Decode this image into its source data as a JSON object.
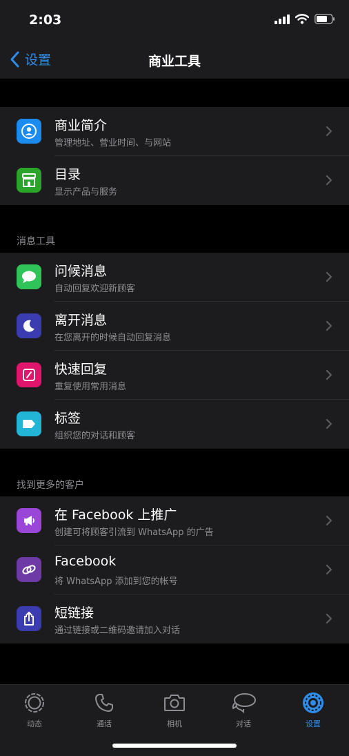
{
  "status_bar": {
    "time": "2:03"
  },
  "nav": {
    "back_label": "设置",
    "title": "商业工具"
  },
  "sections": [
    {
      "header": "",
      "items": [
        {
          "title": "商业简介",
          "subtitle": "管理地址、营业时间、与网站",
          "icon": "business-profile-icon",
          "color": "#1a8cf0"
        },
        {
          "title": "目录",
          "subtitle": "显示产品与服务",
          "icon": "storefront-icon",
          "color": "#2aa52a"
        }
      ]
    },
    {
      "header": "消息工具",
      "items": [
        {
          "title": "问候消息",
          "subtitle": "自动回复欢迎新顾客",
          "icon": "chat-bubble-icon",
          "color": "#30c35a"
        },
        {
          "title": "离开消息",
          "subtitle": "在您离开的时候自动回复消息",
          "icon": "moon-icon",
          "color": "#3a3cb0"
        },
        {
          "title": "快速回复",
          "subtitle": "重复使用常用消息",
          "icon": "quick-reply-icon",
          "color": "#e0156c"
        },
        {
          "title": "标签",
          "subtitle": "组织您的对话和顾客",
          "icon": "label-tag-icon",
          "color": "#22b5d6"
        }
      ]
    },
    {
      "header": "找到更多的客户",
      "items": [
        {
          "title": "在 Facebook 上推广",
          "subtitle": "创建可将顾客引流到 WhatsApp 的广告",
          "icon": "megaphone-icon",
          "color": "#9a46d6"
        },
        {
          "title": "Facebook",
          "subtitle": "将 WhatsApp 添加到您的帐号",
          "icon": "link-chain-icon",
          "color": "#6e3aa6"
        },
        {
          "title": "短链接",
          "subtitle": "通过链接或二维码邀请加入对话",
          "icon": "share-icon",
          "color": "#3a3cb0"
        }
      ]
    }
  ],
  "tabbar": {
    "items": [
      {
        "label": "动态",
        "icon": "status-icon",
        "active": false
      },
      {
        "label": "通话",
        "icon": "phone-icon",
        "active": false
      },
      {
        "label": "相机",
        "icon": "camera-icon",
        "active": false
      },
      {
        "label": "对话",
        "icon": "chats-icon",
        "active": false
      },
      {
        "label": "设置",
        "icon": "settings-gear-icon",
        "active": true
      }
    ]
  },
  "colors": {
    "accent": "#2f8ce8",
    "background": "#000000",
    "cell": "#1c1c1e",
    "secondary_text": "#8d8d93"
  }
}
